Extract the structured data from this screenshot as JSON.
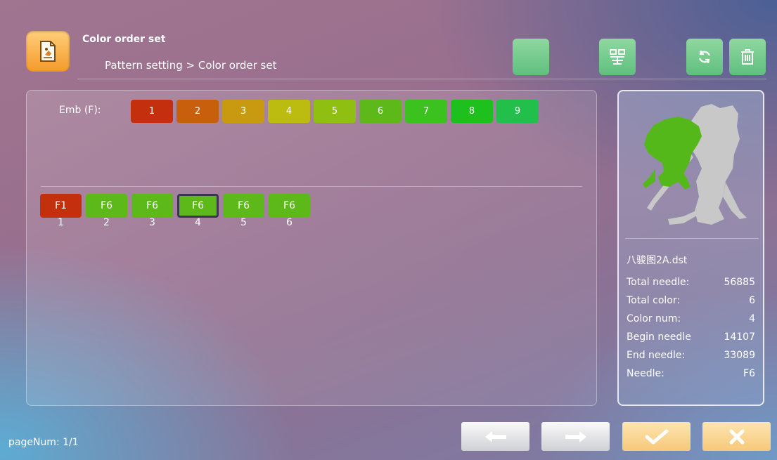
{
  "header": {
    "title": "Color order set",
    "breadcrumb": "Pattern setting > Color order set",
    "icon": "pattern-doc-icon"
  },
  "toolbar": {
    "buttons": [
      {
        "name": "blank-tool-button",
        "icon": ""
      },
      {
        "name": "pattern-layout-button",
        "icon": "pattern-grid-icon"
      },
      {
        "name": "refresh-button",
        "icon": "refresh-icon"
      },
      {
        "name": "delete-button",
        "icon": "trash-icon"
      }
    ]
  },
  "emb": {
    "label": "Emb (F):",
    "buttons": [
      {
        "label": "1",
        "color": "#c4300e"
      },
      {
        "label": "2",
        "color": "#c85f0c"
      },
      {
        "label": "3",
        "color": "#c99a10"
      },
      {
        "label": "4",
        "color": "#bcbc10"
      },
      {
        "label": "5",
        "color": "#8fbf10"
      },
      {
        "label": "6",
        "color": "#5db81a"
      },
      {
        "label": "7",
        "color": "#3cc21e"
      },
      {
        "label": "8",
        "color": "#1ec01e"
      },
      {
        "label": "9",
        "color": "#22c04a"
      }
    ]
  },
  "sequence": [
    {
      "label": "F1",
      "num": "1",
      "color": "#c4300e",
      "selected": false
    },
    {
      "label": "F6",
      "num": "2",
      "color": "#5db81a",
      "selected": false
    },
    {
      "label": "F6",
      "num": "3",
      "color": "#5db81a",
      "selected": false
    },
    {
      "label": "F6",
      "num": "4",
      "color": "#5db81a",
      "selected": true
    },
    {
      "label": "F6",
      "num": "5",
      "color": "#5db81a",
      "selected": false
    },
    {
      "label": "F6",
      "num": "6",
      "color": "#5db81a",
      "selected": false
    }
  ],
  "info": {
    "file_name": "八骏图2A.dst",
    "stats": [
      {
        "label": "Total needle:",
        "value": "56885"
      },
      {
        "label": "Total color:",
        "value": "6"
      },
      {
        "label": "Color num:",
        "value": "4"
      },
      {
        "label": "Begin needle",
        "value": "14107"
      },
      {
        "label": "End needle:",
        "value": "33089"
      },
      {
        "label": "Needle:",
        "value": "F6"
      }
    ]
  },
  "footer": {
    "page_num": "pageNum: 1/1",
    "buttons": [
      {
        "name": "prev-button",
        "icon": "arrow-left-icon"
      },
      {
        "name": "next-button",
        "icon": "arrow-right-icon"
      },
      {
        "name": "confirm-button",
        "icon": "check-icon"
      },
      {
        "name": "cancel-button",
        "icon": "close-icon"
      }
    ]
  },
  "colors": {
    "accent_orange": "#f49a2a",
    "tool_green": "#5fbf7f",
    "preview_green": "#55b81a",
    "preview_gray": "#c8c8c8"
  }
}
